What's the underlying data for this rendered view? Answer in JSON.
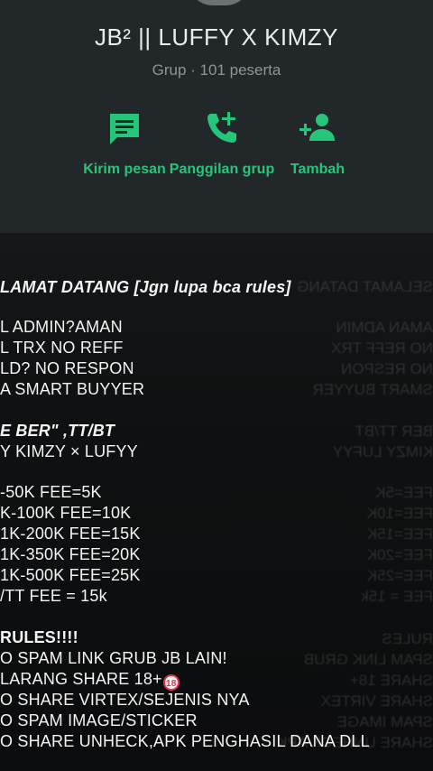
{
  "header": {
    "title": "JB² || LUFFY X KIMZY",
    "subtitle": "Grup · 101 peserta",
    "accent_color": "#25c57a",
    "actions": [
      {
        "label": "Kirim pesan",
        "icon": "message-icon"
      },
      {
        "label": "Panggilan grup",
        "icon": "add-call-icon"
      },
      {
        "label": "Tambah",
        "icon": "add-person-icon"
      }
    ]
  },
  "message": {
    "lines": [
      "LAMAT DATANG [Jgn lupa bca rules]",
      "L ADMIN?AMAN",
      "L TRX NO REFF",
      "LD? NO RESPON",
      " A SMART BUYYER",
      "E BER\" ,TT/BT",
      "Y KIMZY × LUFYY",
      "-50K FEE=5K",
      "K-100K FEE=10K",
      "1K-200K FEE=15K",
      "1K-350K FEE=20K",
      "1K-500K FEE=25K",
      "/TT FEE = 15k",
      "RULES!!!!",
      "O SPAM LINK GRUB JB LAIN!",
      " LARANG SHARE 18+",
      "O SHARE VIRTEX/SEJENIS NYA",
      "O SPAM IMAGE/STICKER",
      "O SHARE UNHECK,APK PENGHASIL DANA DLL"
    ],
    "badge_18": "18"
  }
}
